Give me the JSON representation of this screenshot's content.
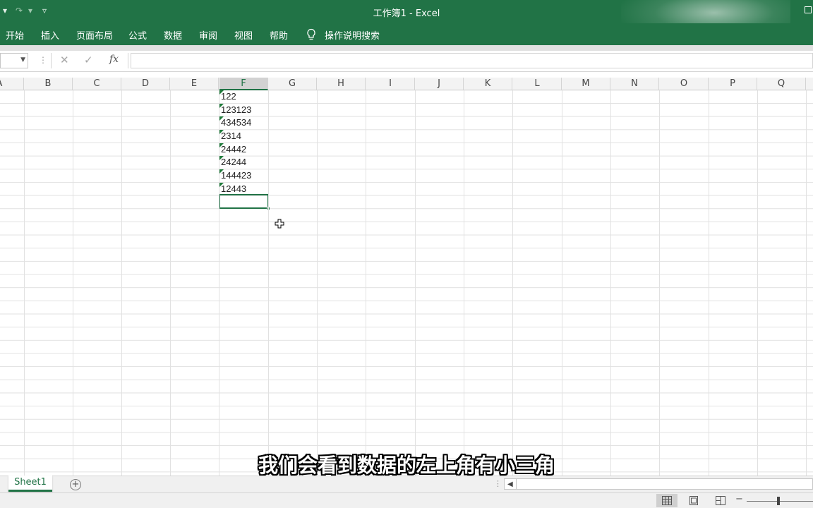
{
  "app": {
    "window_title": "工作簿1  -  Excel"
  },
  "ribbon": {
    "tabs": [
      "开始",
      "插入",
      "页面布局",
      "公式",
      "数据",
      "审阅",
      "视图",
      "帮助"
    ],
    "tell_me": "操作说明搜索",
    "tell_me_icon": "lightbulb-icon"
  },
  "formula_bar": {
    "cancel_symbol": "✕",
    "enter_symbol": "✓",
    "function_symbol": "fx",
    "separator": "⋮",
    "content": ""
  },
  "columns": [
    "A",
    "B",
    "C",
    "D",
    "E",
    "F",
    "G",
    "H",
    "I",
    "J",
    "K",
    "L",
    "M",
    "N",
    "O",
    "P",
    "Q"
  ],
  "selected_column": "F",
  "cells_column_F": [
    "122",
    "123123",
    "434534",
    "2314",
    "24442",
    "24244",
    "144423",
    "12443"
  ],
  "subtitle": "我们会看到数据的左上角有小三角",
  "sheets": {
    "tabs": [
      "Sheet1"
    ],
    "add_symbol": "+"
  },
  "status_bar": {
    "views": [
      "normal-view-icon",
      "page-layout-view-icon",
      "page-break-view-icon"
    ],
    "zoom_minus": "−"
  },
  "colors": {
    "accent": "#217346",
    "error_indicator": "#1e7b3a"
  }
}
